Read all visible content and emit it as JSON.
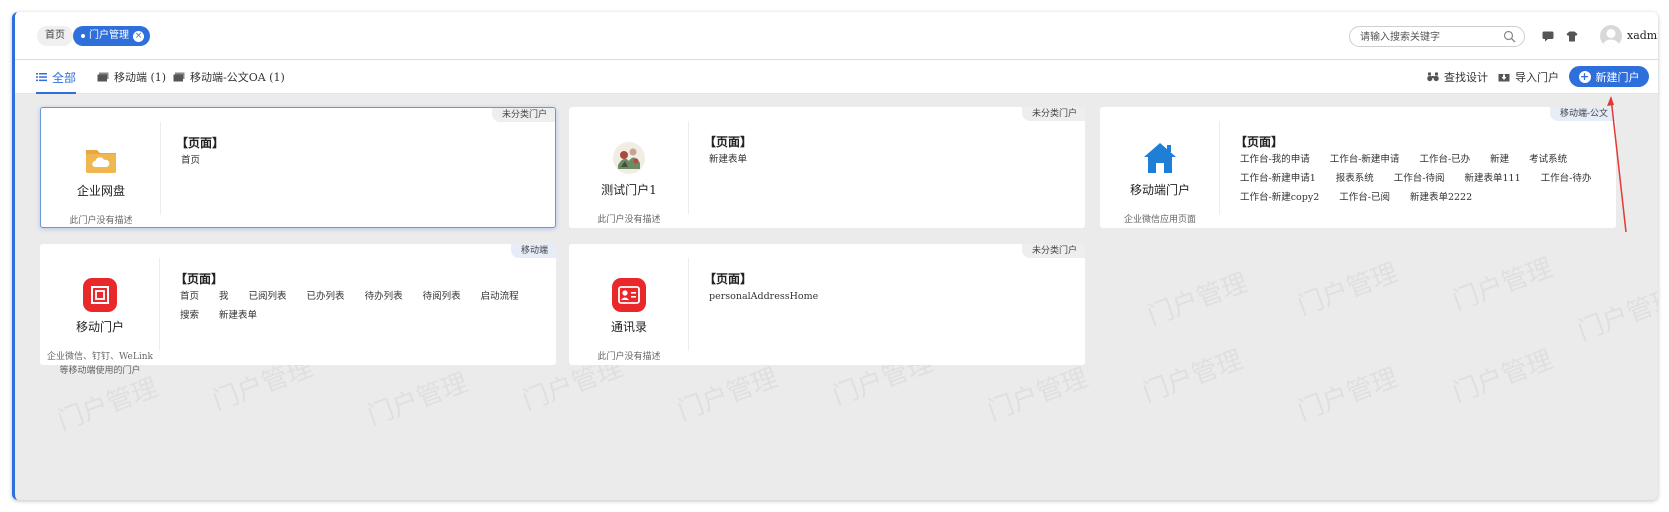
{
  "breadcrumb": {
    "home": "首页",
    "active": "门户管理"
  },
  "search": {
    "placeholder": "请输入搜索关键字"
  },
  "user": {
    "name": "xadmin"
  },
  "tabs": [
    {
      "label": "全部"
    },
    {
      "label": "移动端 (1)"
    },
    {
      "label": "移动端-公文OA (1)"
    }
  ],
  "toolbar": {
    "find_design": "查找设计",
    "import_portal": "导入门户",
    "new_portal": "新建门户"
  },
  "watermark": "门户管理",
  "pages_heading": "【页面】",
  "cards": [
    {
      "name": "企业网盘",
      "desc": "此门户没有描述",
      "badge": "未分类门户",
      "icon": "folder-cloud-icon",
      "pages": [
        "首页"
      ]
    },
    {
      "name": "测试门户1",
      "desc": "此门户没有描述",
      "badge": "未分类门户",
      "icon": "painting-image",
      "pages": [
        "新建表单"
      ]
    },
    {
      "name": "移动端门户",
      "desc": "企业微信应用页面",
      "badge": "移动端-公文",
      "icon": "house-icon",
      "pages": [
        "工作台-我的申请",
        "工作台-新建申请",
        "工作台-已办",
        "新建",
        "考试系统",
        "工作台-新建申请1",
        "报表系统",
        "工作台-待阅",
        "新建表单111",
        "工作台-待办",
        "工作台-新建copy2",
        "工作台-已阅",
        "新建表单2222"
      ]
    },
    {
      "name": "移动门户",
      "desc": "企业微信、钉钉、WeLink等移动端使用的门户",
      "badge": "移动端",
      "icon": "mobile-portal-icon",
      "pages": [
        "首页",
        "我",
        "已阅列表",
        "已办列表",
        "待办列表",
        "待阅列表",
        "启动流程",
        "搜索",
        "新建表单"
      ]
    },
    {
      "name": "通讯录",
      "desc": "此门户没有描述",
      "badge": "未分类门户",
      "icon": "contact-card-icon",
      "pages": [
        "personalAddressHome"
      ]
    }
  ],
  "colors": {
    "accent": "#2f6fdb",
    "red_logo": "#e8282b",
    "folder": "#e8a742",
    "annotation": "#e53935"
  }
}
